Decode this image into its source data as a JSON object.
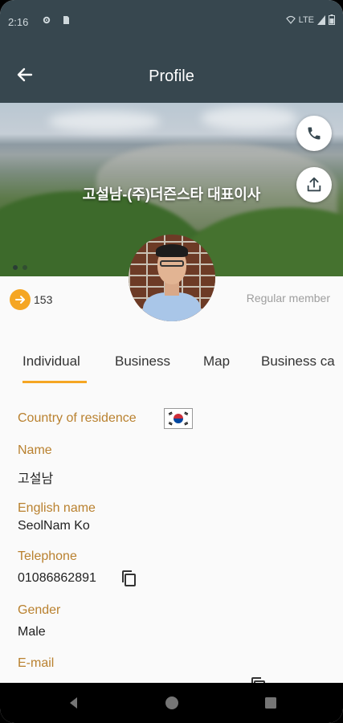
{
  "status_bar": {
    "time": "2:16",
    "network": "LTE"
  },
  "app_bar": {
    "title": "Profile"
  },
  "cover": {
    "title": "고설남-(주)더즌스타 대표이사"
  },
  "profile": {
    "points": "153",
    "membership": "Regular member"
  },
  "tabs": [
    {
      "label": "Individual"
    },
    {
      "label": "Business"
    },
    {
      "label": "Map"
    },
    {
      "label": "Business ca"
    }
  ],
  "fields": {
    "country_label": "Country of residence",
    "name_label": "Name",
    "name_value": "고설남",
    "english_name_label": "English name",
    "english_name_value": "SeolNam Ko",
    "telephone_label": "Telephone",
    "telephone_value": "01086862891",
    "gender_label": "Gender",
    "gender_value": "Male",
    "email_label": "E-mail"
  },
  "colors": {
    "app_bar": "#37474f",
    "accent": "#f5a623",
    "field_label": "#b9812f"
  }
}
